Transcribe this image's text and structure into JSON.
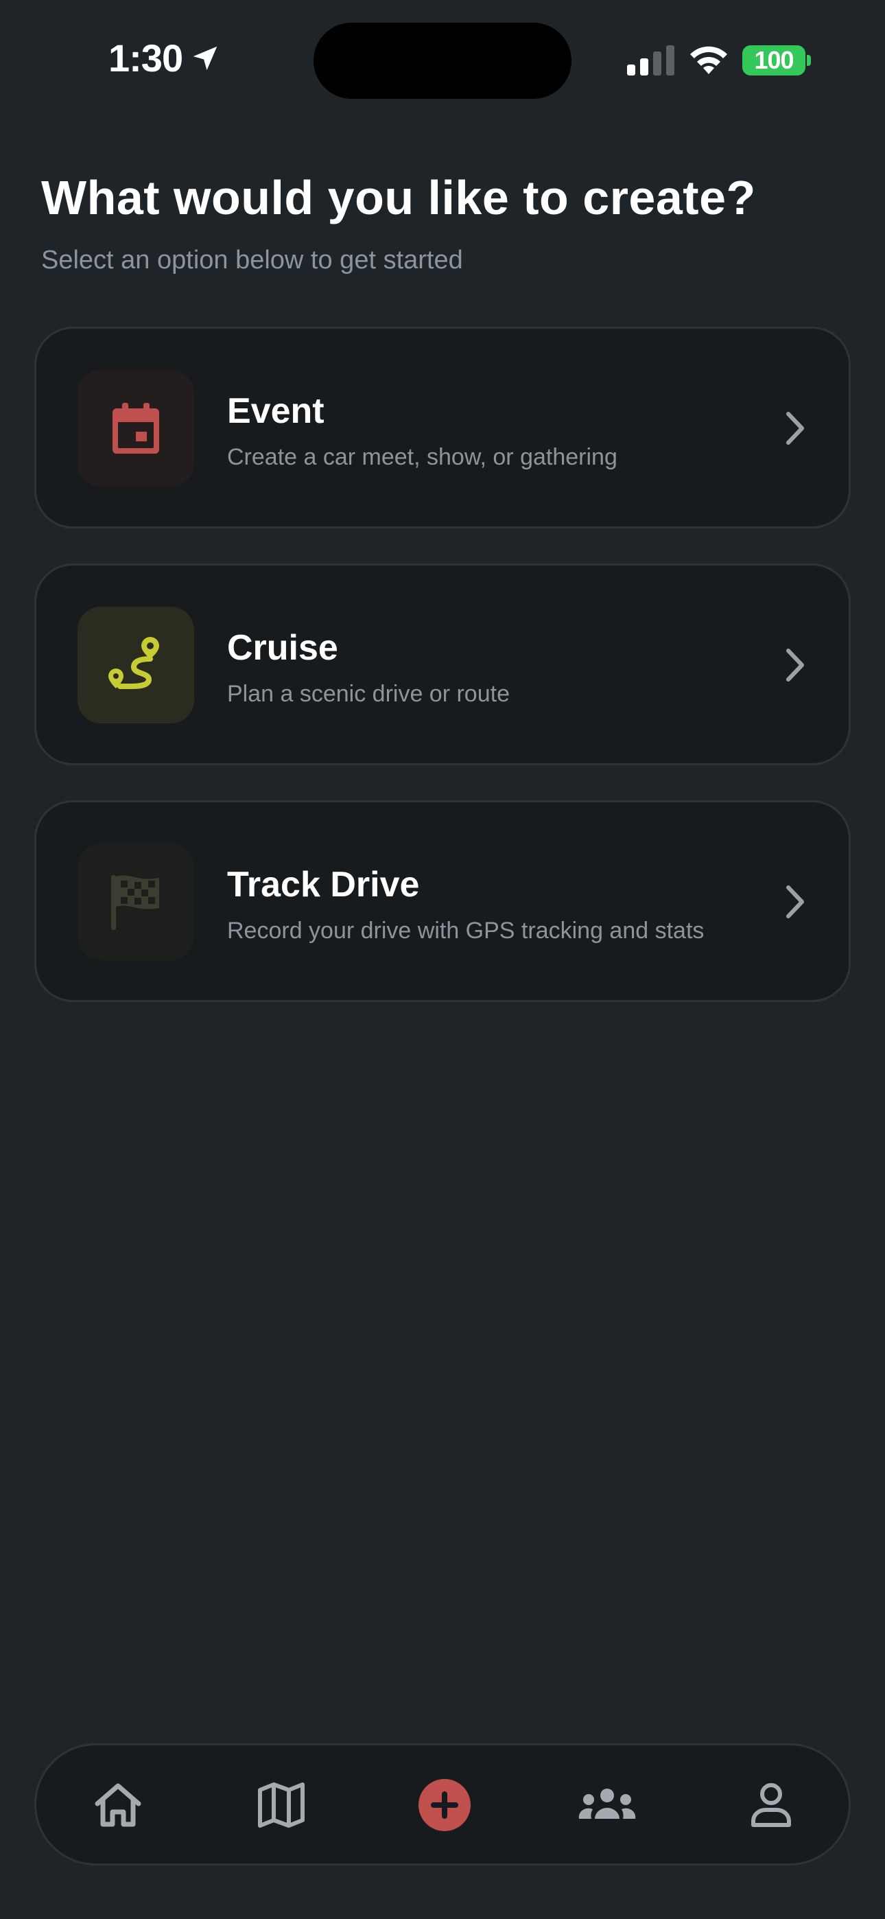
{
  "status_bar": {
    "time": "1:30",
    "battery": "100",
    "battery_color": "#34c759"
  },
  "header": {
    "title": "What would you like to create?",
    "subtitle": "Select an option below to get started"
  },
  "options": [
    {
      "title": "Event",
      "description": "Create a car meet, show, or gathering",
      "icon": "calendar-icon",
      "accent": "#c0504d"
    },
    {
      "title": "Cruise",
      "description": "Plan a scenic drive or route",
      "icon": "route-icon",
      "accent": "#c8cc34"
    },
    {
      "title": "Track Drive",
      "description": "Record your drive with GPS tracking and stats",
      "icon": "checkered-flag-icon",
      "accent": "#3a3d30"
    }
  ],
  "bottom_nav": {
    "items": [
      {
        "icon": "home-icon"
      },
      {
        "icon": "map-icon"
      },
      {
        "icon": "plus-icon",
        "active": true
      },
      {
        "icon": "group-icon"
      },
      {
        "icon": "profile-icon"
      }
    ],
    "active_color": "#c0504d"
  }
}
